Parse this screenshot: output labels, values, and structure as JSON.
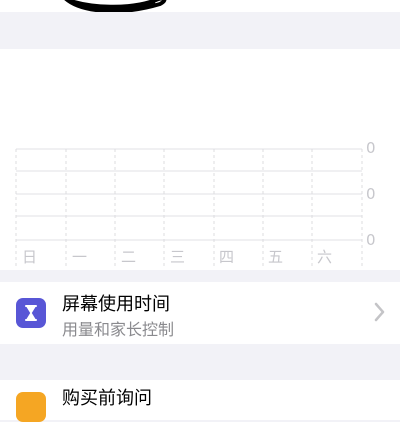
{
  "chart": {
    "weekdays": [
      "日",
      "一",
      "二",
      "三",
      "四",
      "五",
      "六"
    ],
    "y_values": [
      "0",
      "0",
      "0"
    ]
  },
  "screen_time": {
    "title": "屏幕使用时间",
    "subtitle": "用量和家长控制",
    "icon": "hourglass-icon"
  },
  "ask_to_buy": {
    "title": "购买前询问",
    "icon": "cart-icon"
  },
  "colors": {
    "background": "#f2f2f7",
    "screen_time_icon": "#5856d6",
    "ask_to_buy_icon": "#f5a623"
  }
}
